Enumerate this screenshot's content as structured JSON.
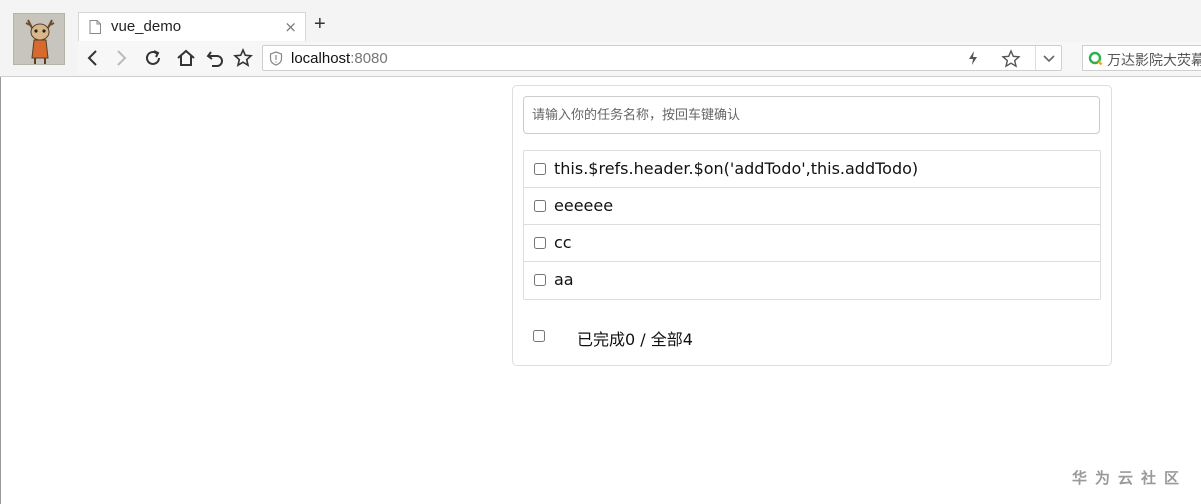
{
  "browser": {
    "tab_title": "vue_demo",
    "tab_close": "×",
    "new_tab": "+",
    "url_host": "localhost",
    "url_port": ":8080",
    "search_text": "万达影院大荧幕"
  },
  "todo": {
    "input_placeholder": "请输入你的任务名称，按回车键确认",
    "items": [
      {
        "title": "this.$refs.header.$on('addTodo',this.addTodo)",
        "complete": false
      },
      {
        "title": "eeeeee",
        "complete": false
      },
      {
        "title": "cc",
        "complete": false
      },
      {
        "title": "aa",
        "complete": false
      }
    ],
    "footer_text": "已完成0 / 全部4",
    "completed_count": 0,
    "total_count": 4
  },
  "watermark": "华为云社区",
  "colors": {
    "border": "#dddddd",
    "chrome_bg": "#f4f4f4",
    "search_icon": "#2bb24c"
  }
}
